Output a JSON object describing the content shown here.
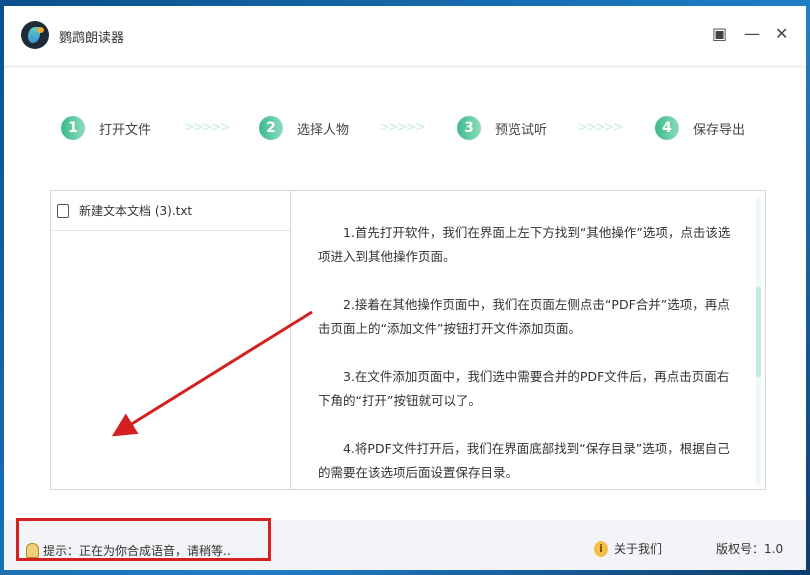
{
  "app": {
    "title": "鹦鹉朗读器"
  },
  "window_controls": {
    "layout": "▣",
    "minimize": "—",
    "close": "✕"
  },
  "steps": [
    {
      "num": "1",
      "label": "打开文件"
    },
    {
      "num": "2",
      "label": "选择人物"
    },
    {
      "num": "3",
      "label": "预览试听"
    },
    {
      "num": "4",
      "label": "保存导出"
    }
  ],
  "step_separator": ">>>>>",
  "files": [
    {
      "name": "新建文本文档 (3).txt"
    }
  ],
  "content": {
    "paragraphs": [
      "1.首先打开软件，我们在界面上左下方找到“其他操作”选项，点击该选项进入到其他操作页面。",
      "2.接着在其他操作页面中，我们在页面左侧点击“PDF合并”选项，再点击页面上的“添加文件”按钮打开文件添加页面。",
      "3.在文件添加页面中，我们选中需要合并的PDF文件后，再点击页面右下角的“打开”按钮就可以了。",
      "4.将PDF文件打开后，我们在界面底部找到“保存目录”选项，根据自己的需要在该选项后面设置保存目录。"
    ]
  },
  "footer": {
    "tip": "提示：正在为你合成语音，请稍等..",
    "about": "关于我们",
    "version": "版权号：1.0",
    "info_icon": "i"
  },
  "colors": {
    "accent": "#3cba8c",
    "annotation": "#d42020"
  }
}
